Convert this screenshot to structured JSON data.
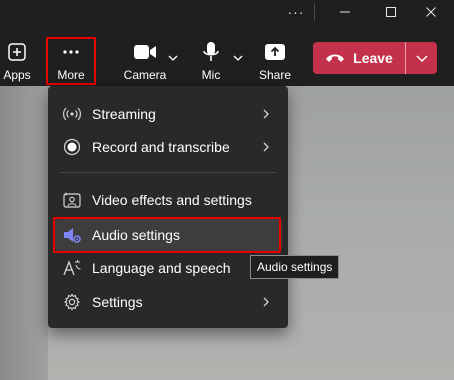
{
  "titlebar": {
    "more_glyph": "···",
    "minimize_icon": "minimize-icon",
    "maximize_icon": "maximize-icon",
    "close_icon": "close-icon"
  },
  "toolbar": {
    "apps_label": "Apps",
    "more_label": "More",
    "camera_label": "Camera",
    "mic_label": "Mic",
    "share_label": "Share",
    "leave_label": "Leave",
    "leave_color": "#c4314b"
  },
  "menu": {
    "items": [
      {
        "label": "Streaming",
        "icon": "streaming-icon",
        "has_submenu": true
      },
      {
        "label": "Record and transcribe",
        "icon": "record-icon",
        "has_submenu": true
      },
      {
        "label": "Video effects and settings",
        "icon": "video-effects-icon",
        "has_submenu": false
      },
      {
        "label": "Audio settings",
        "icon": "audio-settings-icon",
        "has_submenu": false,
        "active": true
      },
      {
        "label": "Language and speech",
        "icon": "language-icon",
        "has_submenu": false
      },
      {
        "label": "Settings",
        "icon": "gear-icon",
        "has_submenu": true
      }
    ]
  },
  "tooltip": {
    "text": "Audio settings"
  },
  "highlight_color": "#e60000",
  "accent_color": "#7f85f5"
}
